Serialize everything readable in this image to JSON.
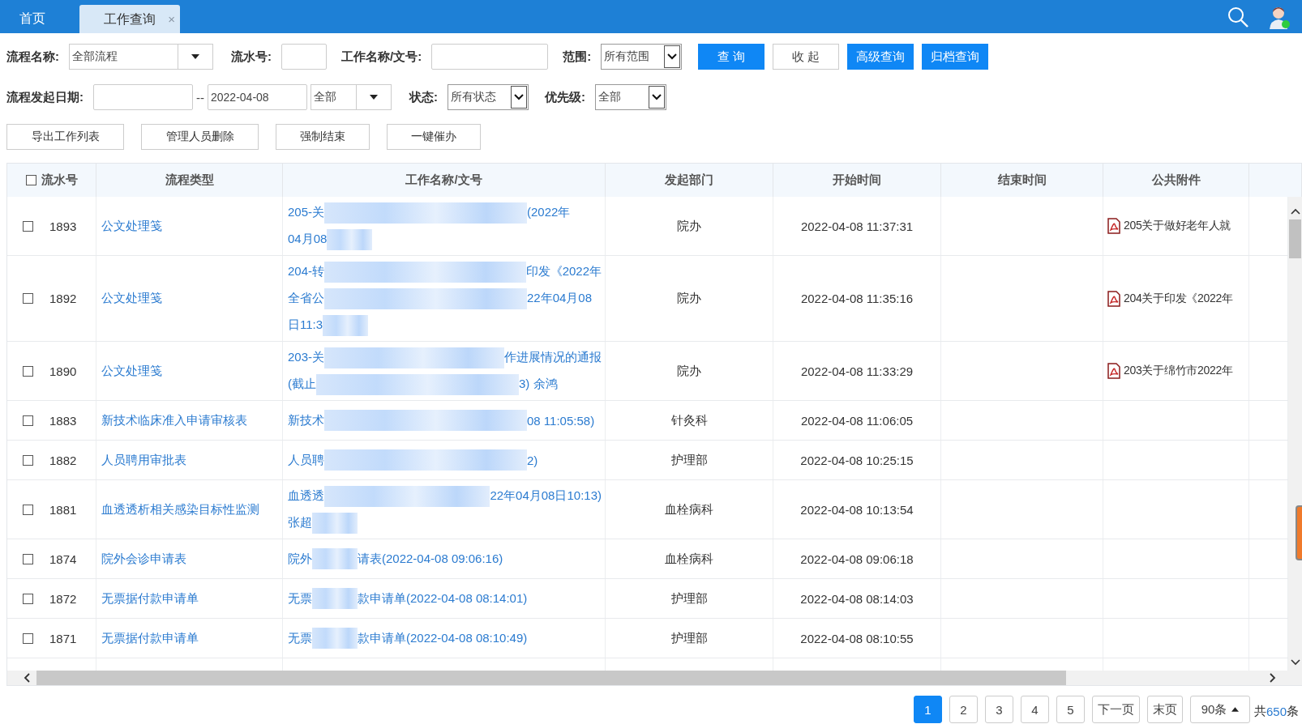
{
  "tabs": [
    {
      "label": "首页",
      "selected": false,
      "closable": false
    },
    {
      "label": "工作查询",
      "selected": true,
      "closable": true
    }
  ],
  "close_mark": "×",
  "filters": {
    "row1": [
      {
        "kind": "combo",
        "label": "流程名称:",
        "value": "全部流程"
      },
      {
        "kind": "short",
        "label": "流水号:"
      },
      {
        "kind": "input",
        "label": "工作名称/文号:"
      },
      {
        "kind": "native",
        "label": "范围:",
        "value": "所有范围"
      }
    ],
    "row1_buttons": [
      {
        "label": "查 询",
        "primary": true
      },
      {
        "label": "收 起",
        "primary": false
      },
      {
        "label": "高级查询",
        "primary": true
      },
      {
        "label": "归档查询",
        "primary": true
      }
    ],
    "date_label": "流程发起日期:",
    "date_sep": "--",
    "date_to": "2022-04-08",
    "row2": [
      {
        "kind": "combo",
        "value": "全部"
      },
      {
        "kind": "native",
        "label": "状态:",
        "value": "所有状态"
      },
      {
        "kind": "native",
        "label": "优先级:",
        "value": "全部"
      }
    ],
    "actions": [
      "导出工作列表",
      "管理人员删除",
      "强制结束",
      "一键催办"
    ]
  },
  "table": {
    "header_checked": false,
    "columns": [
      "流水号",
      "流程类型",
      "工作名称/文号",
      "发起部门",
      "开始时间",
      "结束时间",
      "公共附件"
    ],
    "rows": [
      {
        "checked": false,
        "id": "1893",
        "type": "公文处理笺",
        "lines": [
          [
            {
              "kind": "text",
              "text": "205-关"
            },
            {
              "kind": "blur"
            },
            {
              "kind": "text",
              "text": "(2022年"
            }
          ],
          [
            {
              "kind": "text",
              "text": "04月08"
            },
            {
              "kind": "blur-short"
            }
          ]
        ],
        "dept": "院办",
        "start": "2022-04-08 11:37:31",
        "attachment": "205关于做好老年人就"
      },
      {
        "checked": false,
        "id": "1892",
        "type": "公文处理笺",
        "lines": [
          [
            {
              "kind": "text",
              "text": "204-转"
            },
            {
              "kind": "blur"
            },
            {
              "kind": "text",
              "text": "印发《2022年"
            }
          ],
          [
            {
              "kind": "text",
              "text": "全省公"
            },
            {
              "kind": "blur"
            },
            {
              "kind": "text",
              "text": "22年04月08"
            }
          ],
          [
            {
              "kind": "text",
              "text": "日11:3"
            },
            {
              "kind": "blur-short"
            }
          ]
        ],
        "dept": "院办",
        "start": "2022-04-08 11:35:16",
        "attachment": "204关于印发《2022年"
      },
      {
        "checked": false,
        "id": "1890",
        "type": "公文处理笺",
        "lines": [
          [
            {
              "kind": "text",
              "text": "203-关"
            },
            {
              "kind": "blur"
            },
            {
              "kind": "text",
              "text": "作进展情况的通报"
            }
          ],
          [
            {
              "kind": "text",
              "text": "(截止"
            },
            {
              "kind": "blur"
            },
            {
              "kind": "text",
              "text": "3) 余鸿"
            }
          ]
        ],
        "dept": "院办",
        "start": "2022-04-08 11:33:29",
        "attachment": "203关于绵竹市2022年"
      },
      {
        "checked": false,
        "id": "1883",
        "type": "新技术临床准入申请审核表",
        "lines": [
          [
            {
              "kind": "text",
              "text": "新技术"
            },
            {
              "kind": "blur"
            },
            {
              "kind": "text",
              "text": "08 11:05:58)"
            }
          ]
        ],
        "dept": "针灸科",
        "start": "2022-04-08 11:06:05"
      },
      {
        "checked": false,
        "id": "1882",
        "type": "人员聘用审批表",
        "lines": [
          [
            {
              "kind": "text",
              "text": "人员聘"
            },
            {
              "kind": "blur"
            },
            {
              "kind": "text",
              "text": "2)"
            }
          ]
        ],
        "dept": "护理部",
        "start": "2022-04-08 10:25:15"
      },
      {
        "checked": false,
        "id": "1881",
        "type": "血透透析相关感染目标性监测",
        "lines": [
          [
            {
              "kind": "text",
              "text": "血透透"
            },
            {
              "kind": "blur"
            },
            {
              "kind": "text",
              "text": "22年04月08日10:13)"
            }
          ],
          [
            {
              "kind": "text",
              "text": "张超"
            },
            {
              "kind": "blur-short"
            }
          ]
        ],
        "dept": "血栓病科",
        "start": "2022-04-08 10:13:54"
      },
      {
        "checked": false,
        "id": "1874",
        "type": "院外会诊申请表",
        "lines": [
          [
            {
              "kind": "text",
              "text": "院外"
            },
            {
              "kind": "blur-short"
            },
            {
              "kind": "text",
              "text": "请表(2022-04-08 09:06:16)"
            }
          ]
        ],
        "dept": "血栓病科",
        "start": "2022-04-08 09:06:18"
      },
      {
        "checked": false,
        "id": "1872",
        "type": "无票据付款申请单",
        "lines": [
          [
            {
              "kind": "text",
              "text": "无票"
            },
            {
              "kind": "blur-short"
            },
            {
              "kind": "text",
              "text": "款申请单(2022-04-08 08:14:01)"
            }
          ]
        ],
        "dept": "护理部",
        "start": "2022-04-08 08:14:03"
      },
      {
        "checked": false,
        "id": "1871",
        "type": "无票据付款申请单",
        "lines": [
          [
            {
              "kind": "text",
              "text": "无票"
            },
            {
              "kind": "blur-short"
            },
            {
              "kind": "text",
              "text": "款申请单(2022-04-08 08:10:49)"
            }
          ]
        ],
        "dept": "护理部",
        "start": "2022-04-08 08:10:55"
      }
    ]
  },
  "pagination": {
    "pages": [
      {
        "label": "1",
        "selected": true
      },
      {
        "label": "2",
        "selected": false
      },
      {
        "label": "3",
        "selected": false
      },
      {
        "label": "4",
        "selected": false
      },
      {
        "label": "5",
        "selected": false
      }
    ],
    "next": "下一页",
    "last": "末页",
    "page_size": "90条",
    "total_prefix": "共",
    "total": "650",
    "total_suffix": "条"
  }
}
